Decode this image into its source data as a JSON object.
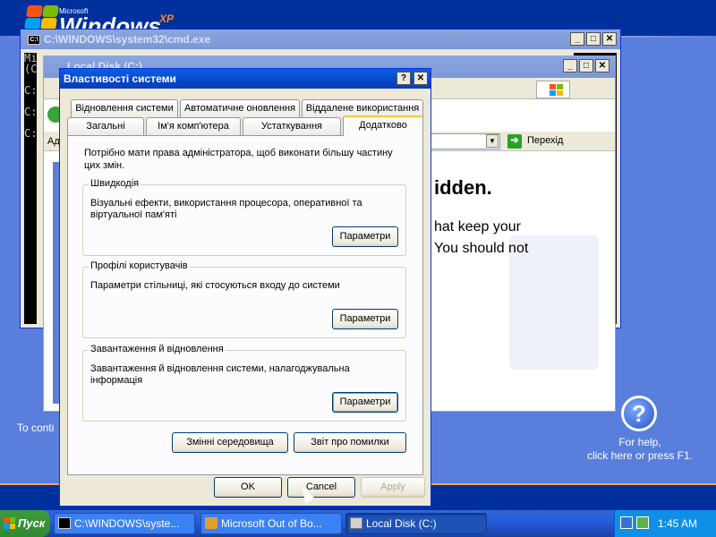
{
  "desktop": {
    "brand_small": "Microsoft",
    "brand_big": "Windows",
    "brand_sup": "XP",
    "to_continue": "To conti",
    "help_glyph": "?",
    "help_line1": "For help,",
    "help_line2": "click here or press F1."
  },
  "cmd_window": {
    "title": "C:\\WINDOWS\\system32\\cmd.exe",
    "icon_text": "C:\\",
    "text_lines": [
      "Mi",
      "(C",
      "",
      "C:",
      "",
      "C:",
      "",
      "C:"
    ]
  },
  "explorer_window": {
    "title": "Local Disk (C:)",
    "address_label": "Ад",
    "go_label": "Перехід",
    "heading_fragment": "idden.",
    "text_line1": "hat keep your",
    "text_line2": "You should not"
  },
  "dialog": {
    "title": "Властивості системи",
    "help_btn": "?",
    "close_btn": "✕",
    "tabs_row1": [
      "Відновлення системи",
      "Автоматичне оновлення",
      "Віддалене використання"
    ],
    "tabs_row2": [
      "Загальні",
      "Ім'я комп'ютера",
      "Устаткування",
      "Додатково"
    ],
    "active_tab": "Додатково",
    "admin_note": "Потрібно мати права адміністратора, щоб виконати більшу частину цих змін.",
    "groups": [
      {
        "title": "Швидкодія",
        "desc": "Візуальні ефекти, використання процесора, оперативної та віртуальної пам'яті",
        "button": "Параметри"
      },
      {
        "title": "Профілі користувачів",
        "desc": "Параметри стільниці, які стосуються входу до системи",
        "button": "Параметри"
      },
      {
        "title": "Завантаження й відновлення",
        "desc": "Завантаження й відновлення системи, налагоджувальна інформація",
        "button": "Параметри"
      }
    ],
    "env_button": "Змінні середовища",
    "error_button": "Звіт про помилки",
    "ok": "OK",
    "cancel": "Cancel",
    "apply": "Apply"
  },
  "taskbar": {
    "start": "Пуск",
    "tasks": [
      {
        "label": "C:\\WINDOWS\\syste...",
        "active": false
      },
      {
        "label": "Microsoft Out of Bo...",
        "active": false
      },
      {
        "label": "Local Disk (C:)",
        "active": true
      }
    ],
    "clock": "1:45 AM"
  },
  "colors": {
    "titlebar_active": "#0846c9",
    "desktop_blue": "#5a7edc",
    "tab_highlight": "#ffc73c",
    "start_green": "#2f8a2f"
  }
}
